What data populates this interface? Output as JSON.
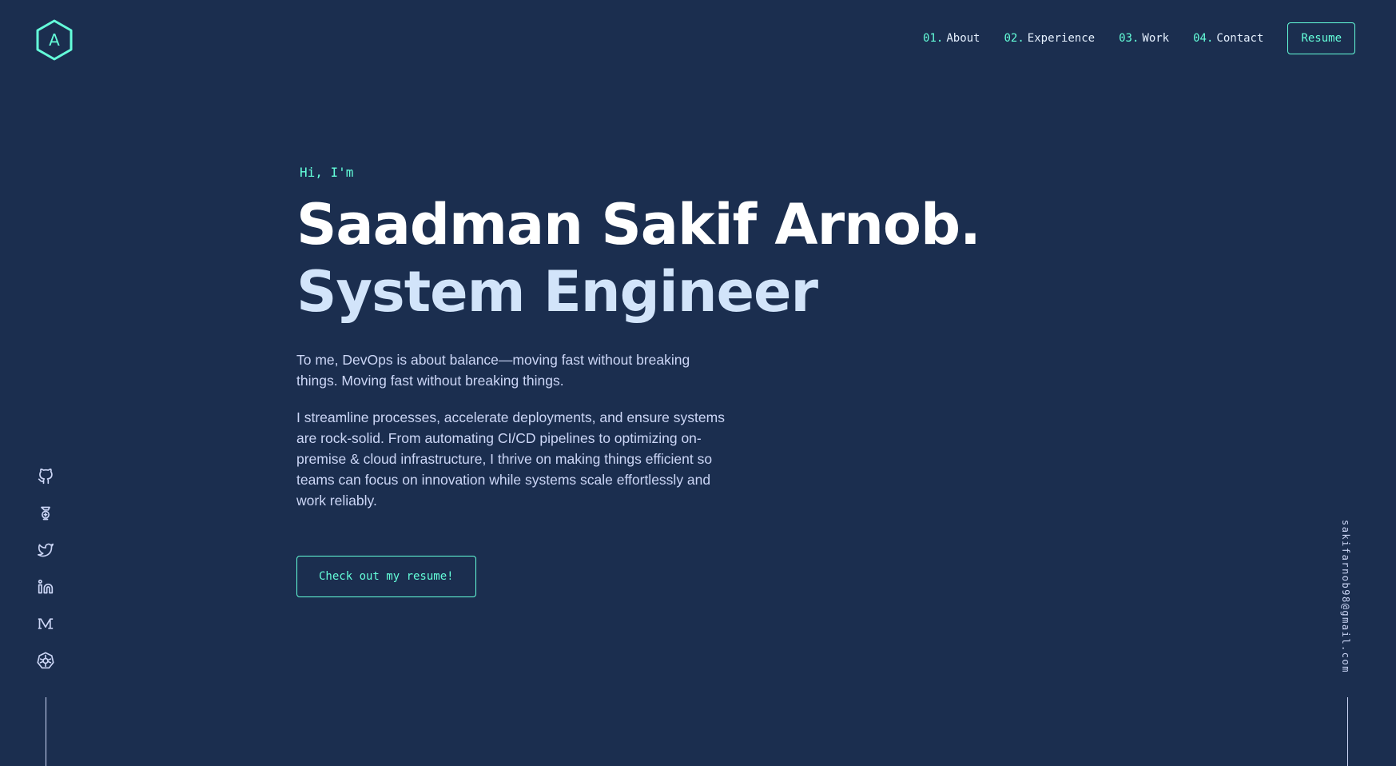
{
  "logo": {
    "letter": "A",
    "icon": "hexagon-logo-icon"
  },
  "nav": {
    "items": [
      {
        "num": "01.",
        "label": "About"
      },
      {
        "num": "02.",
        "label": "Experience"
      },
      {
        "num": "03.",
        "label": "Work"
      },
      {
        "num": "04.",
        "label": "Contact"
      }
    ],
    "resume_label": "Resume"
  },
  "hero": {
    "greeting": "Hi, I'm",
    "name": "Saadman Sakif Arnob.",
    "role": "System Engineer",
    "paragraph1": "To me, DevOps is about balance—moving fast without breaking things. Moving fast without breaking things.",
    "paragraph2": "I streamline processes, accelerate deployments, and ensure systems are rock-solid. From automating CI/CD pipelines to optimizing on-premise & cloud infrastructure, I thrive on making things efficient so teams can focus on innovation while systems scale effortlessly and work reliably.",
    "cta_label": "Check out my resume!"
  },
  "socials": [
    {
      "icon": "github-icon"
    },
    {
      "icon": "hackerrank-icon"
    },
    {
      "icon": "twitter-icon"
    },
    {
      "icon": "linkedin-icon"
    },
    {
      "icon": "medium-icon"
    },
    {
      "icon": "kubernetes-icon"
    }
  ],
  "email": "sakifarnob98@gmail.com",
  "colors": {
    "background": "#1b2e4f",
    "accent": "#64ffda",
    "heading": "#ffffff",
    "subheading": "#d2e4fa",
    "text": "#ccd6f6"
  }
}
